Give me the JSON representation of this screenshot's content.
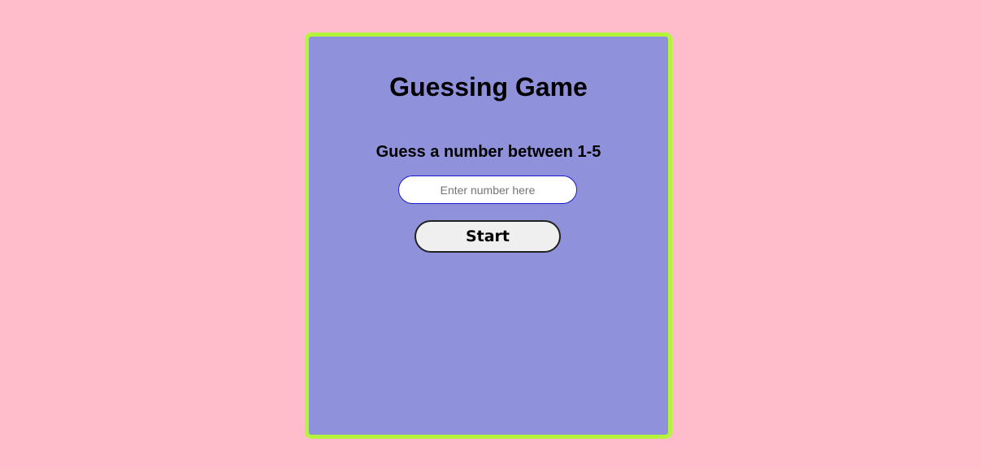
{
  "game": {
    "title": "Guessing Game",
    "prompt": "Guess a number between 1-5",
    "input_placeholder": "Enter number here",
    "input_value": "",
    "start_label": "Start"
  },
  "colors": {
    "page_background": "#ffbdcb",
    "card_background": "#9091db",
    "card_border": "#b4f53c",
    "input_border": "#1a1acc",
    "button_background": "#efefef"
  }
}
